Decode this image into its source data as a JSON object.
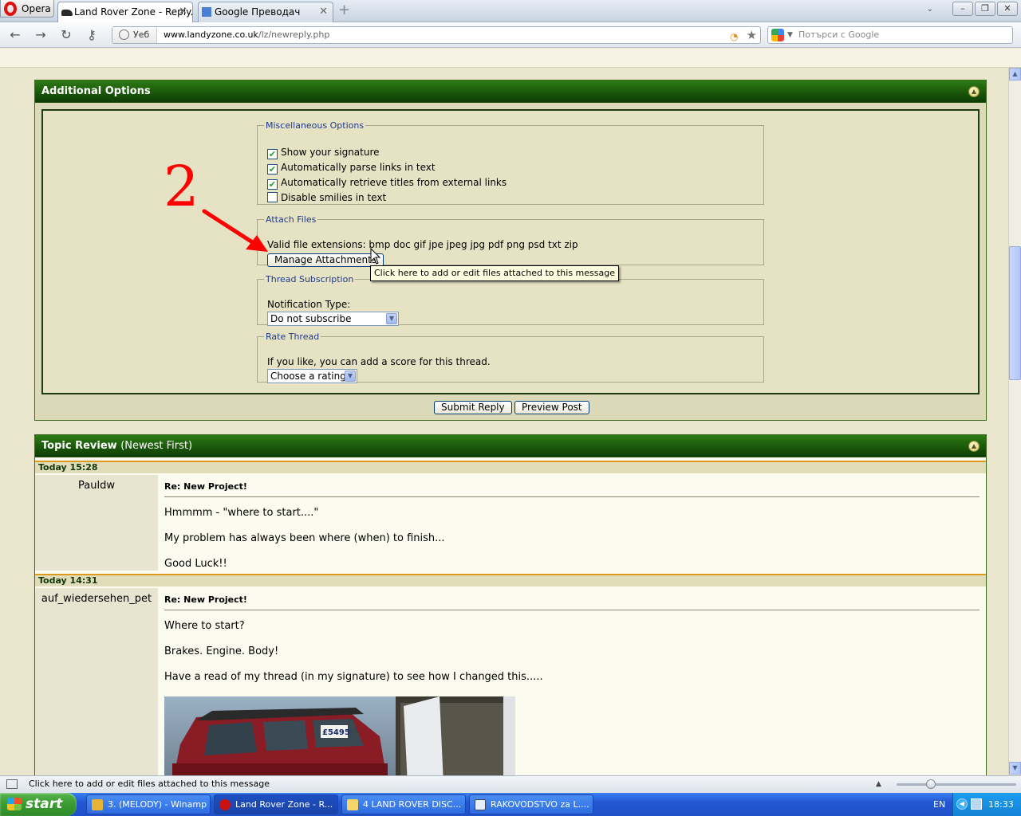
{
  "browser": {
    "menu_label": "Opera",
    "tabs": [
      {
        "label": "Land Rover Zone - Reply..."
      },
      {
        "label": "Google Преводач"
      }
    ],
    "security_label": "Уеб",
    "url_host": "www.landyzone.co.uk",
    "url_path": "/lz/newreply.php",
    "search_placeholder": "Потърси с Google"
  },
  "additional_options": {
    "header": "Additional Options",
    "misc": {
      "legend": "Miscellaneous Options",
      "options": [
        {
          "label": "Show your signature",
          "checked": true
        },
        {
          "label": "Automatically parse links in text",
          "checked": true
        },
        {
          "label": "Automatically retrieve titles from external links",
          "checked": true
        },
        {
          "label": "Disable smilies in text",
          "checked": false
        }
      ]
    },
    "attach": {
      "legend": "Attach Files",
      "extensions": "Valid file extensions: bmp doc gif jpe jpeg jpg pdf png psd txt zip",
      "button": "Manage Attachments",
      "tooltip": "Click here to add or edit files attached to this message"
    },
    "subscription": {
      "legend": "Thread Subscription",
      "label": "Notification Type:",
      "selected": "Do not subscribe"
    },
    "rate": {
      "legend": "Rate Thread",
      "label": "If you like, you can add a score for this thread.",
      "selected": "Choose a rating"
    },
    "annotation": "2"
  },
  "actions": {
    "submit": "Submit Reply",
    "preview": "Preview Post"
  },
  "topic_review": {
    "header": "Topic Review",
    "header_note": "(Newest First)",
    "posts": [
      {
        "date": "Today 15:28",
        "user": "Pauldw",
        "title": "Re: New Project!",
        "lines": [
          "Hmmmm - \"where to start....\"",
          "My problem has always been where (when) to finish...",
          "Good Luck!!"
        ]
      },
      {
        "date": "Today 14:31",
        "user": "auf_wiedersehen_pet",
        "title": "Re: New Project!",
        "lines": [
          "Where to start?",
          "Brakes. Engine. Body!",
          "Have a read of my thread (in my signature) to see how I changed this....."
        ],
        "photo_sign": "£5495"
      }
    ]
  },
  "status_bar": {
    "text": "Click here to add or edit files attached to this message"
  },
  "taskbar": {
    "start": "start",
    "tasks": [
      {
        "label": "3. (MELODY) - Winamp"
      },
      {
        "label": "Land Rover Zone - R..."
      },
      {
        "label": "4 LAND ROVER DISC..."
      },
      {
        "label": "RAKOVODSTVO za L...."
      }
    ],
    "language": "EN",
    "clock": "18:33"
  }
}
